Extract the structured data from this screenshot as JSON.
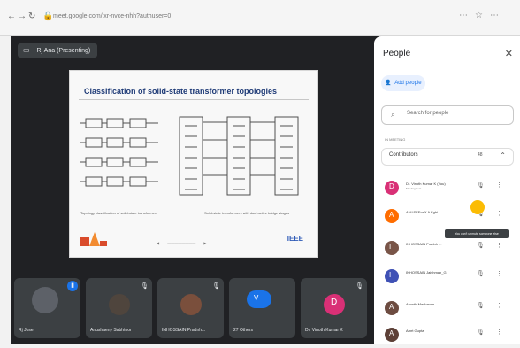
{
  "browser": {
    "url": "meet.google.com/jxr-nvce-nhh?authuser=0"
  },
  "meeting": {
    "present_chip": "Rj Ana (Presenting)",
    "slide_title": "Classification of solid-state transformer topologies",
    "caption_left": "Topology classification of solid-state transformers",
    "caption_right": "Solid-state transformers with dual active bridge stages",
    "brand": "IEEE"
  },
  "participants": [
    {
      "name": "Rj Jose",
      "mic": "on",
      "color": "#4a4f55"
    },
    {
      "name": "Anushaeny Sabhtoor",
      "mic": "muted",
      "color": "#3e4348"
    },
    {
      "name": "INHOSSAIN Pradnh...",
      "mic": "muted",
      "color": "#3e4348"
    },
    {
      "name": "27 Others",
      "mic": "on",
      "color": "#3e4348"
    },
    {
      "name": "Dr. Vinoth Kumar K",
      "mic": "muted",
      "color": "#3e4348",
      "avatar_letter": "D",
      "avatar_color": "#d93076"
    }
  ],
  "people_panel": {
    "title": "People",
    "add_people": "Add people",
    "search_placeholder": "Search for people",
    "in_meeting_label": "IN MEETING",
    "contributors_label": "Contributors",
    "contributors_count": "48",
    "people": [
      {
        "name": "Dr. Vinoth Kumar K (You)",
        "subtitle": "Meeting host",
        "avatar_color": "#d93076",
        "avatar_letter": "D"
      },
      {
        "name": "ANUSEEnaX A Kghi",
        "subtitle": "",
        "avatar_color": "#ff6d00",
        "avatar_letter": "A"
      },
      {
        "name": "INHOSSAIN Pradnh ...",
        "subtitle": "",
        "avatar_color": "#795548",
        "avatar_letter": "I"
      },
      {
        "name": "INHOSSAIN Jaishman_G",
        "subtitle": "",
        "avatar_color": "#3f51b5",
        "avatar_letter": "I"
      },
      {
        "name": "Anusth Madhavan",
        "subtitle": "",
        "avatar_color": "#6d4c41",
        "avatar_letter": "A"
      },
      {
        "name": "Amrt Gupta",
        "subtitle": "",
        "avatar_color": "#5d4037",
        "avatar_letter": "A"
      }
    ],
    "tooltip": "You can't unmute someone else"
  }
}
